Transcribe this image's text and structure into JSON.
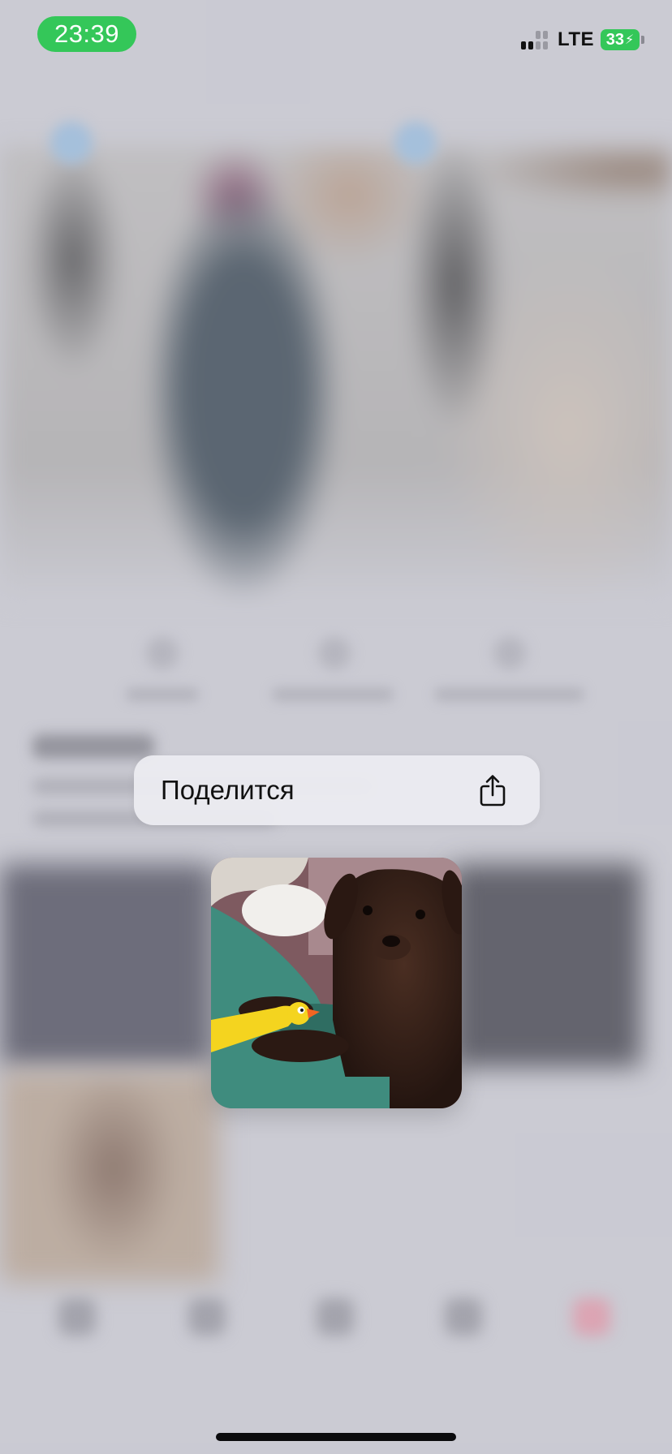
{
  "status_bar": {
    "time": "23:39",
    "network": "LTE",
    "battery_level": "33",
    "battery_state": "charging",
    "time_pill_color": "#34c759"
  },
  "context_menu": {
    "items": [
      {
        "label": "Поделится",
        "icon": "share-icon"
      }
    ]
  },
  "preview": {
    "image_subject": "chocolate labrador puppy with yellow rubber duck toy"
  }
}
